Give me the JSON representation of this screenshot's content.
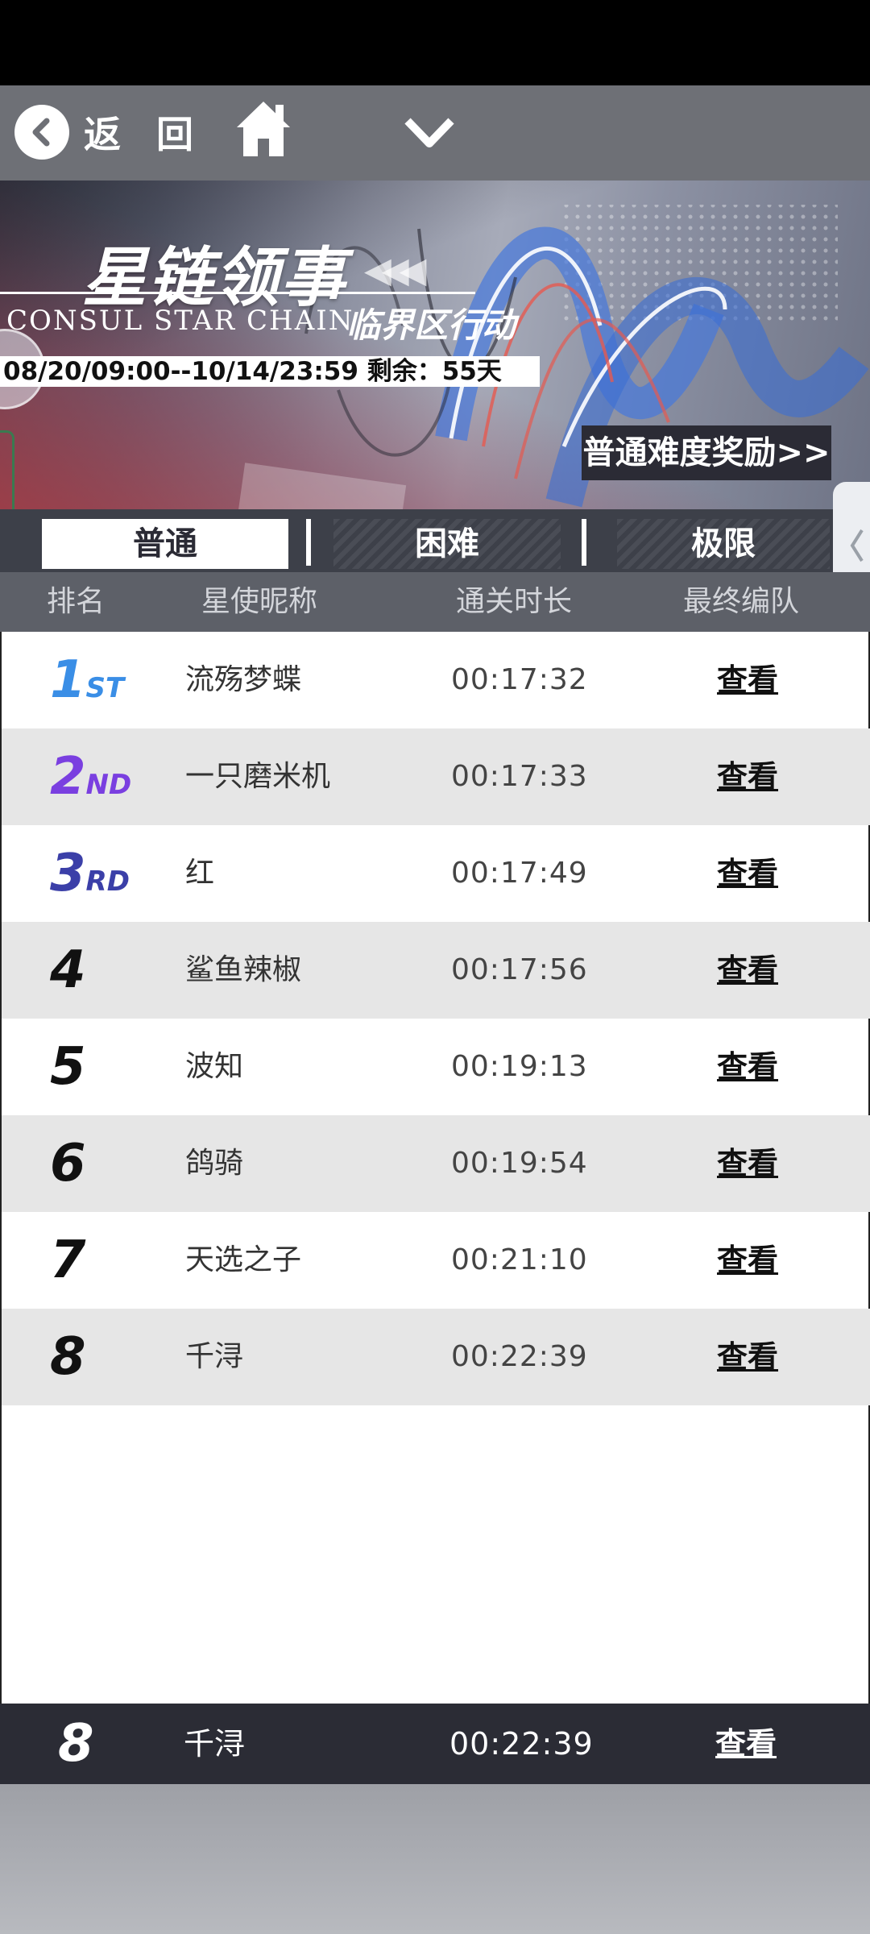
{
  "topbar": {
    "back_label": "返 回",
    "icons": [
      "back-arrow-icon",
      "home-icon",
      "chevron-down-icon"
    ]
  },
  "banner": {
    "title": "星链领事",
    "title_en": "CONSUL STAR CHAIN",
    "subtitle": "临界区行动",
    "period": "08/20/09:00--10/14/23:59 剩余：55天",
    "reward_button": "普通难度奖励>>"
  },
  "tabs": [
    {
      "label": "普通",
      "active": true
    },
    {
      "label": "困难",
      "active": false
    },
    {
      "label": "极限",
      "active": false
    }
  ],
  "columns": {
    "rank": "排名",
    "name": "星使昵称",
    "time": "通关时长",
    "team": "最终编队"
  },
  "rows": [
    {
      "rank": "1",
      "suffix": "ST",
      "name": "流殇梦蝶",
      "time": "00:17:32",
      "action": "查看",
      "color": "#3a8ee6"
    },
    {
      "rank": "2",
      "suffix": "ND",
      "name": "一只磨米机",
      "time": "00:17:33",
      "action": "查看",
      "color": "#7a3fe0"
    },
    {
      "rank": "3",
      "suffix": "RD",
      "name": "红",
      "time": "00:17:49",
      "action": "查看",
      "color": "#3b3fa8"
    },
    {
      "rank": "4",
      "suffix": "",
      "name": "鲨鱼辣椒",
      "time": "00:17:56",
      "action": "查看",
      "color": "#111111"
    },
    {
      "rank": "5",
      "suffix": "",
      "name": "波知",
      "time": "00:19:13",
      "action": "查看",
      "color": "#111111"
    },
    {
      "rank": "6",
      "suffix": "",
      "name": "鸽骑",
      "time": "00:19:54",
      "action": "查看",
      "color": "#111111"
    },
    {
      "rank": "7",
      "suffix": "",
      "name": "天选之子",
      "time": "00:21:10",
      "action": "查看",
      "color": "#111111"
    },
    {
      "rank": "8",
      "suffix": "",
      "name": "千浔",
      "time": "00:22:39",
      "action": "查看",
      "color": "#111111"
    }
  ],
  "self": {
    "rank": "8",
    "name": "千浔",
    "time": "00:22:39",
    "action": "查看"
  }
}
